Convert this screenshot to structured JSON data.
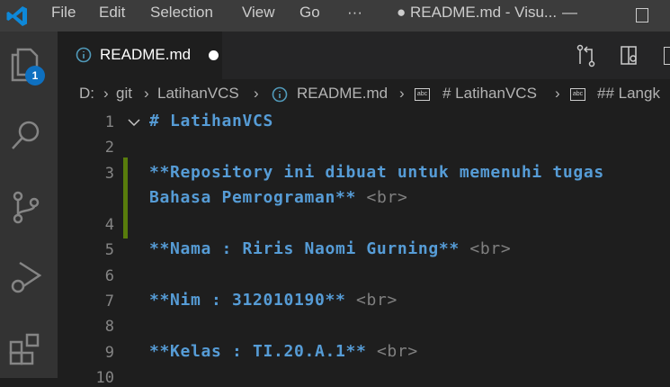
{
  "titlebar": {
    "menus": [
      "File",
      "Edit",
      "Selection",
      "View",
      "Go",
      "···"
    ],
    "title": "● README.md - Visu...",
    "minimize": "—"
  },
  "activity": {
    "explorer_badge": "1"
  },
  "tab": {
    "label": "README.md"
  },
  "breadcrumb": [
    "D:",
    "git",
    "LatihanVCS",
    "README.md",
    "# LatihanVCS",
    "## Langk"
  ],
  "editor": {
    "lines": [
      {
        "n": "1",
        "text": "# LatihanVCS"
      },
      {
        "n": "2",
        "text": ""
      },
      {
        "n": "3",
        "text": "**Repository ini dibuat untuk memenuhi tugas",
        "wrap": "Bahasa Pemrograman**",
        "tag": "<br>"
      },
      {
        "n": "4",
        "text": ""
      },
      {
        "n": "5",
        "text": "**Nama : Riris Naomi Gurning**",
        "tag": "<br>"
      },
      {
        "n": "6",
        "text": ""
      },
      {
        "n": "7",
        "text": "**Nim : 312010190**",
        "tag": "<br>"
      },
      {
        "n": "8",
        "text": ""
      },
      {
        "n": "9",
        "text": "**Kelas : TI.20.A.1**",
        "tag": "<br>"
      },
      {
        "n": "10",
        "text": ""
      }
    ]
  },
  "colors": {
    "accent": "#0e70c0",
    "heading": "#569cd6",
    "modified": "#587c0c"
  }
}
